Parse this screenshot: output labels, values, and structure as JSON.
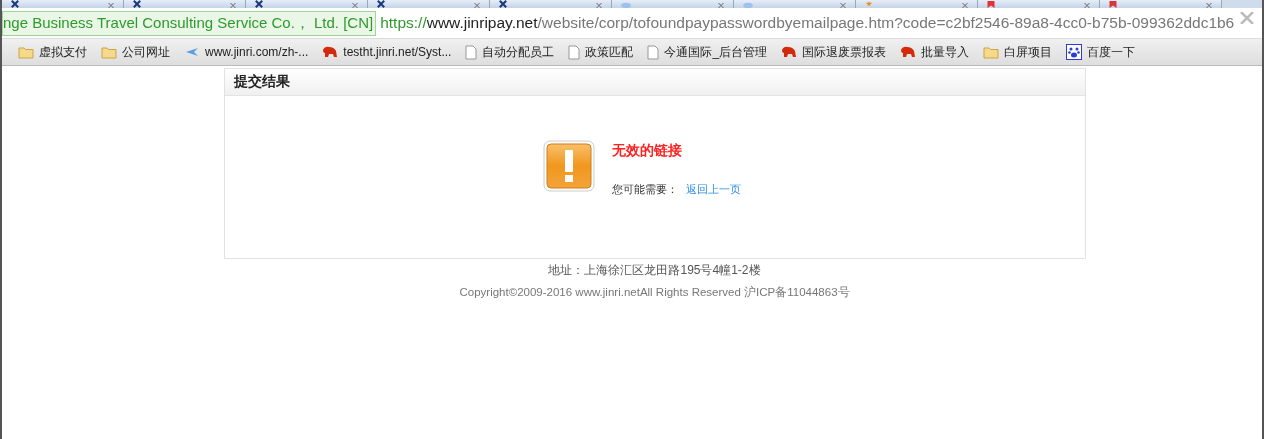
{
  "tabs": [
    {
      "kind": "x"
    },
    {
      "kind": "x"
    },
    {
      "kind": "x"
    },
    {
      "kind": "x"
    },
    {
      "kind": "x"
    },
    {
      "kind": "cloud"
    },
    {
      "kind": "cloud"
    },
    {
      "kind": "star"
    },
    {
      "kind": "flag"
    },
    {
      "kind": "flag"
    }
  ],
  "address_bar": {
    "identity": "nge Business Travel Consulting Service Co.， Ltd. [CN]",
    "scheme": "https://",
    "host": "www.jinripay.net",
    "path": "/website/corp/tofoundpaypasswordbyemailpage.htm?code=c2bf2546-89a8-4cc0-b75b-099362ddc1b6"
  },
  "bookmarks": [
    {
      "kind": "folder",
      "label": "虚拟支付"
    },
    {
      "kind": "folder",
      "label": "公司网址"
    },
    {
      "kind": "plane",
      "label": "www.jinri.com/zh-..."
    },
    {
      "kind": "animal",
      "label": "testht.jinri.net/Syst..."
    },
    {
      "kind": "page",
      "label": "自动分配员工"
    },
    {
      "kind": "page",
      "label": "政策匹配"
    },
    {
      "kind": "page",
      "label": "今通国际_后台管理"
    },
    {
      "kind": "animal",
      "label": "国际退废票报表"
    },
    {
      "kind": "animal",
      "label": "批量导入"
    },
    {
      "kind": "folder",
      "label": "白屏项目"
    },
    {
      "kind": "paw",
      "label": "百度一下"
    }
  ],
  "panel": {
    "title": "提交结果",
    "message": "无效的链接",
    "hint": "您可能需要：",
    "link": "返回上一页"
  },
  "footer": {
    "address": "地址：上海徐汇区龙田路195号4幢1-2楼",
    "copyright": "Copyright©2009-2016 www.jinri.netAll Rights Reserved 沪ICP备11044863号"
  }
}
